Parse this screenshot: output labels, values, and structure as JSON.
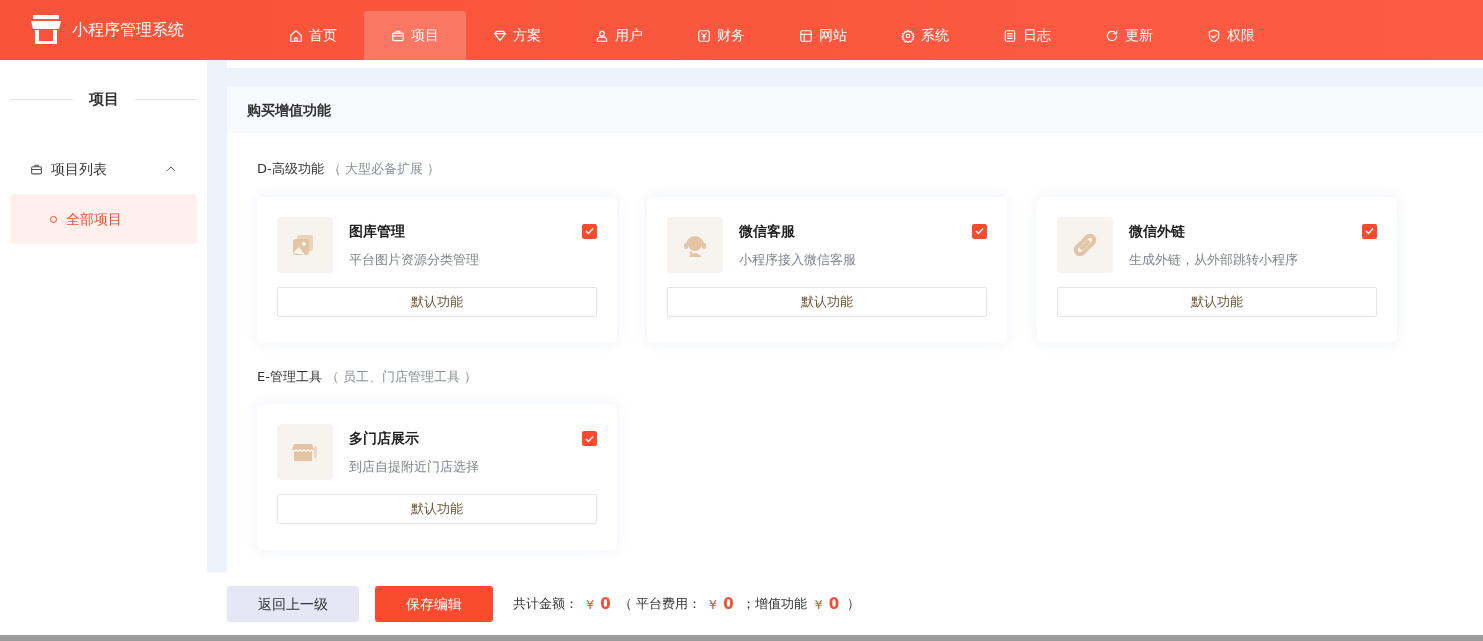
{
  "header": {
    "title": "小程序管理系统"
  },
  "nav": [
    {
      "label": "首页",
      "selected": false
    },
    {
      "label": "项目",
      "selected": true
    },
    {
      "label": "方案",
      "selected": false
    },
    {
      "label": "用户",
      "selected": false
    },
    {
      "label": "财务",
      "selected": false
    },
    {
      "label": "网站",
      "selected": false
    },
    {
      "label": "系统",
      "selected": false
    },
    {
      "label": "日志",
      "selected": false
    },
    {
      "label": "更新",
      "selected": false
    },
    {
      "label": "权限",
      "selected": false
    }
  ],
  "sidebar": {
    "title": "项目",
    "groups": [
      {
        "label": "项目列表",
        "expanded": true,
        "children": [
          {
            "label": "全部项目",
            "selected": true
          }
        ]
      }
    ]
  },
  "panel": {
    "title": "购买增值功能",
    "sections": [
      {
        "title": "D-高级功能",
        "hint": "（ 大型必备扩展 ）",
        "features": [
          {
            "name": "图库管理",
            "description": "平台图片资源分类管理",
            "checked": true,
            "button": "默认功能"
          },
          {
            "name": "微信客服",
            "description": "小程序接入微信客服",
            "checked": true,
            "button": "默认功能"
          },
          {
            "name": "微信外链",
            "description": "生成外链，从外部跳转小程序",
            "checked": true,
            "button": "默认功能"
          }
        ]
      },
      {
        "title": "E-管理工具",
        "hint": "（ 员工、门店管理工具 ）",
        "features": [
          {
            "name": "多门店展示",
            "description": "到店自提附近门店选择",
            "checked": true,
            "button": "默认功能"
          }
        ]
      }
    ]
  },
  "footer": {
    "back_button": "返回上一级",
    "save_button": "保存编辑",
    "summary": [
      {
        "kind": "label",
        "text": "共计金额："
      },
      {
        "kind": "price",
        "currency": "¥",
        "amount": "0"
      },
      {
        "kind": "label",
        "text": "（ 平台费用："
      },
      {
        "kind": "price",
        "currency": "¥",
        "amount": "0"
      },
      {
        "kind": "label",
        "text": "；增值功能"
      },
      {
        "kind": "price",
        "currency": "¥",
        "amount": "0"
      },
      {
        "kind": "label",
        "text": "）"
      }
    ]
  }
}
